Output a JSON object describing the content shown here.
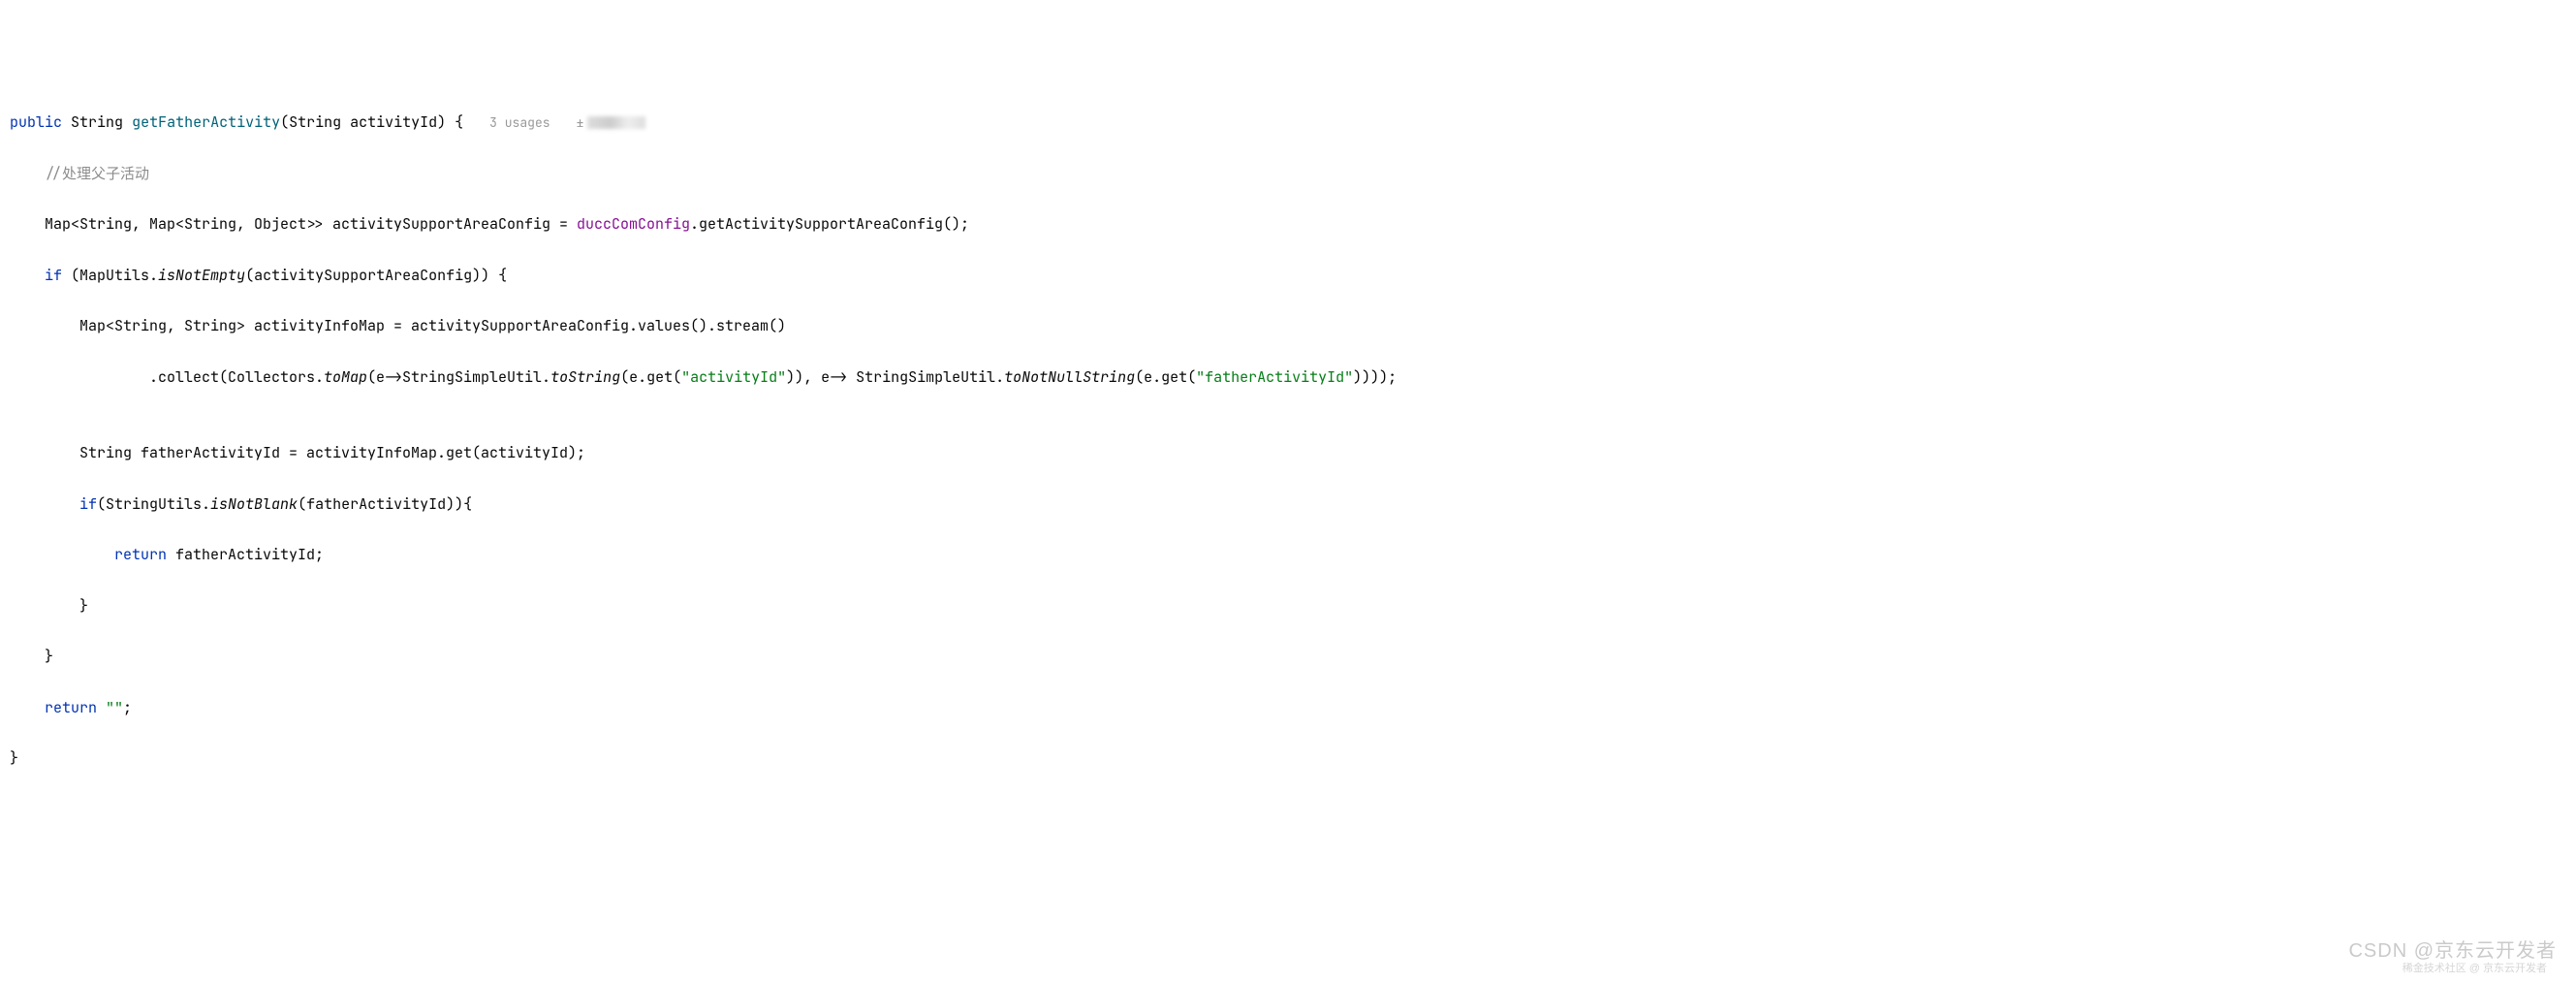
{
  "code": {
    "kw_public": "public",
    "type_string1": "String",
    "method_name": "getFatherActivity",
    "param_type": "String",
    "param_name": "activityId",
    "usages_hint": "3 usages",
    "comment_line": "//处理父子活动",
    "map_decl": "Map<String, Map<String, Object>> activitySupportAreaConfig = ",
    "field_ducc": "duccComConfig",
    "get_config_call": ".getActivitySupportAreaConfig();",
    "kw_if1": "if",
    "maputils": " (MapUtils.",
    "isnotempty": "isNotEmpty",
    "isnotempty_arg": "(activitySupportAreaConfig)) {",
    "infomap_decl": "Map<String, String> activityInfoMap = activitySupportAreaConfig.values().stream()",
    "collect_prefix": ".collect(Collectors.",
    "tomap": "toMap",
    "lambda1_pre": "(e->StringSimpleUtil.",
    "tostring": "toString",
    "lambda1_arg": "(e.get(",
    "str_activityId": "\"activityId\"",
    "lambda1_close": ")), e-> StringSimpleUtil.",
    "tonotnull": "toNotNullString",
    "lambda2_arg": "(e.get(",
    "str_fatherId": "\"fatherActivityId\"",
    "lambda2_close": "))));",
    "father_decl": "String fatherActivityId = activityInfoMap.get(activityId);",
    "kw_if2": "if",
    "stringutils": "(StringUtils.",
    "isnotblank": "isNotBlank",
    "isnotblank_arg": "(fatherActivityId)){",
    "kw_return1": "return",
    "return_val": " fatherActivityId;",
    "close_brace1": "}",
    "close_brace2": "}",
    "kw_return2": "return",
    "empty_str": " \"\"",
    "semicolon": ";",
    "close_brace3": "}"
  },
  "watermark": {
    "main": "CSDN @京东云开发者",
    "sub": "稀金技术社区 @ 京东云开发者"
  }
}
